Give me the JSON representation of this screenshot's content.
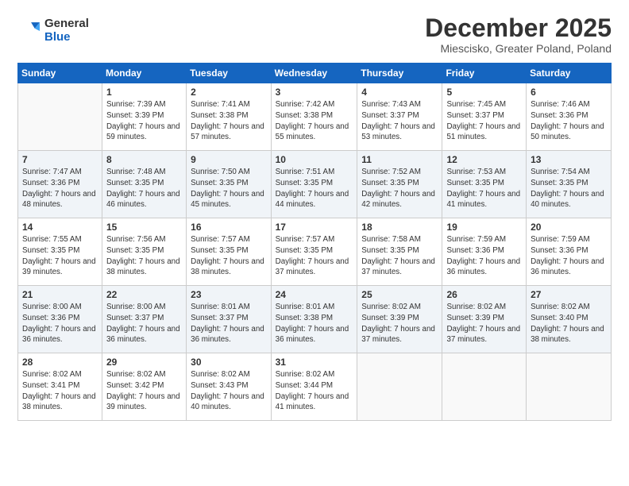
{
  "logo": {
    "general": "General",
    "blue": "Blue"
  },
  "title": "December 2025",
  "subtitle": "Miescisko, Greater Poland, Poland",
  "weekdays": [
    "Sunday",
    "Monday",
    "Tuesday",
    "Wednesday",
    "Thursday",
    "Friday",
    "Saturday"
  ],
  "weeks": [
    [
      {
        "day": "",
        "sunrise": "",
        "sunset": "",
        "daylight": ""
      },
      {
        "day": "1",
        "sunrise": "Sunrise: 7:39 AM",
        "sunset": "Sunset: 3:39 PM",
        "daylight": "Daylight: 7 hours and 59 minutes."
      },
      {
        "day": "2",
        "sunrise": "Sunrise: 7:41 AM",
        "sunset": "Sunset: 3:38 PM",
        "daylight": "Daylight: 7 hours and 57 minutes."
      },
      {
        "day": "3",
        "sunrise": "Sunrise: 7:42 AM",
        "sunset": "Sunset: 3:38 PM",
        "daylight": "Daylight: 7 hours and 55 minutes."
      },
      {
        "day": "4",
        "sunrise": "Sunrise: 7:43 AM",
        "sunset": "Sunset: 3:37 PM",
        "daylight": "Daylight: 7 hours and 53 minutes."
      },
      {
        "day": "5",
        "sunrise": "Sunrise: 7:45 AM",
        "sunset": "Sunset: 3:37 PM",
        "daylight": "Daylight: 7 hours and 51 minutes."
      },
      {
        "day": "6",
        "sunrise": "Sunrise: 7:46 AM",
        "sunset": "Sunset: 3:36 PM",
        "daylight": "Daylight: 7 hours and 50 minutes."
      }
    ],
    [
      {
        "day": "7",
        "sunrise": "Sunrise: 7:47 AM",
        "sunset": "Sunset: 3:36 PM",
        "daylight": "Daylight: 7 hours and 48 minutes."
      },
      {
        "day": "8",
        "sunrise": "Sunrise: 7:48 AM",
        "sunset": "Sunset: 3:35 PM",
        "daylight": "Daylight: 7 hours and 46 minutes."
      },
      {
        "day": "9",
        "sunrise": "Sunrise: 7:50 AM",
        "sunset": "Sunset: 3:35 PM",
        "daylight": "Daylight: 7 hours and 45 minutes."
      },
      {
        "day": "10",
        "sunrise": "Sunrise: 7:51 AM",
        "sunset": "Sunset: 3:35 PM",
        "daylight": "Daylight: 7 hours and 44 minutes."
      },
      {
        "day": "11",
        "sunrise": "Sunrise: 7:52 AM",
        "sunset": "Sunset: 3:35 PM",
        "daylight": "Daylight: 7 hours and 42 minutes."
      },
      {
        "day": "12",
        "sunrise": "Sunrise: 7:53 AM",
        "sunset": "Sunset: 3:35 PM",
        "daylight": "Daylight: 7 hours and 41 minutes."
      },
      {
        "day": "13",
        "sunrise": "Sunrise: 7:54 AM",
        "sunset": "Sunset: 3:35 PM",
        "daylight": "Daylight: 7 hours and 40 minutes."
      }
    ],
    [
      {
        "day": "14",
        "sunrise": "Sunrise: 7:55 AM",
        "sunset": "Sunset: 3:35 PM",
        "daylight": "Daylight: 7 hours and 39 minutes."
      },
      {
        "day": "15",
        "sunrise": "Sunrise: 7:56 AM",
        "sunset": "Sunset: 3:35 PM",
        "daylight": "Daylight: 7 hours and 38 minutes."
      },
      {
        "day": "16",
        "sunrise": "Sunrise: 7:57 AM",
        "sunset": "Sunset: 3:35 PM",
        "daylight": "Daylight: 7 hours and 38 minutes."
      },
      {
        "day": "17",
        "sunrise": "Sunrise: 7:57 AM",
        "sunset": "Sunset: 3:35 PM",
        "daylight": "Daylight: 7 hours and 37 minutes."
      },
      {
        "day": "18",
        "sunrise": "Sunrise: 7:58 AM",
        "sunset": "Sunset: 3:35 PM",
        "daylight": "Daylight: 7 hours and 37 minutes."
      },
      {
        "day": "19",
        "sunrise": "Sunrise: 7:59 AM",
        "sunset": "Sunset: 3:36 PM",
        "daylight": "Daylight: 7 hours and 36 minutes."
      },
      {
        "day": "20",
        "sunrise": "Sunrise: 7:59 AM",
        "sunset": "Sunset: 3:36 PM",
        "daylight": "Daylight: 7 hours and 36 minutes."
      }
    ],
    [
      {
        "day": "21",
        "sunrise": "Sunrise: 8:00 AM",
        "sunset": "Sunset: 3:36 PM",
        "daylight": "Daylight: 7 hours and 36 minutes."
      },
      {
        "day": "22",
        "sunrise": "Sunrise: 8:00 AM",
        "sunset": "Sunset: 3:37 PM",
        "daylight": "Daylight: 7 hours and 36 minutes."
      },
      {
        "day": "23",
        "sunrise": "Sunrise: 8:01 AM",
        "sunset": "Sunset: 3:37 PM",
        "daylight": "Daylight: 7 hours and 36 minutes."
      },
      {
        "day": "24",
        "sunrise": "Sunrise: 8:01 AM",
        "sunset": "Sunset: 3:38 PM",
        "daylight": "Daylight: 7 hours and 36 minutes."
      },
      {
        "day": "25",
        "sunrise": "Sunrise: 8:02 AM",
        "sunset": "Sunset: 3:39 PM",
        "daylight": "Daylight: 7 hours and 37 minutes."
      },
      {
        "day": "26",
        "sunrise": "Sunrise: 8:02 AM",
        "sunset": "Sunset: 3:39 PM",
        "daylight": "Daylight: 7 hours and 37 minutes."
      },
      {
        "day": "27",
        "sunrise": "Sunrise: 8:02 AM",
        "sunset": "Sunset: 3:40 PM",
        "daylight": "Daylight: 7 hours and 38 minutes."
      }
    ],
    [
      {
        "day": "28",
        "sunrise": "Sunrise: 8:02 AM",
        "sunset": "Sunset: 3:41 PM",
        "daylight": "Daylight: 7 hours and 38 minutes."
      },
      {
        "day": "29",
        "sunrise": "Sunrise: 8:02 AM",
        "sunset": "Sunset: 3:42 PM",
        "daylight": "Daylight: 7 hours and 39 minutes."
      },
      {
        "day": "30",
        "sunrise": "Sunrise: 8:02 AM",
        "sunset": "Sunset: 3:43 PM",
        "daylight": "Daylight: 7 hours and 40 minutes."
      },
      {
        "day": "31",
        "sunrise": "Sunrise: 8:02 AM",
        "sunset": "Sunset: 3:44 PM",
        "daylight": "Daylight: 7 hours and 41 minutes."
      },
      {
        "day": "",
        "sunrise": "",
        "sunset": "",
        "daylight": ""
      },
      {
        "day": "",
        "sunrise": "",
        "sunset": "",
        "daylight": ""
      },
      {
        "day": "",
        "sunrise": "",
        "sunset": "",
        "daylight": ""
      }
    ]
  ]
}
